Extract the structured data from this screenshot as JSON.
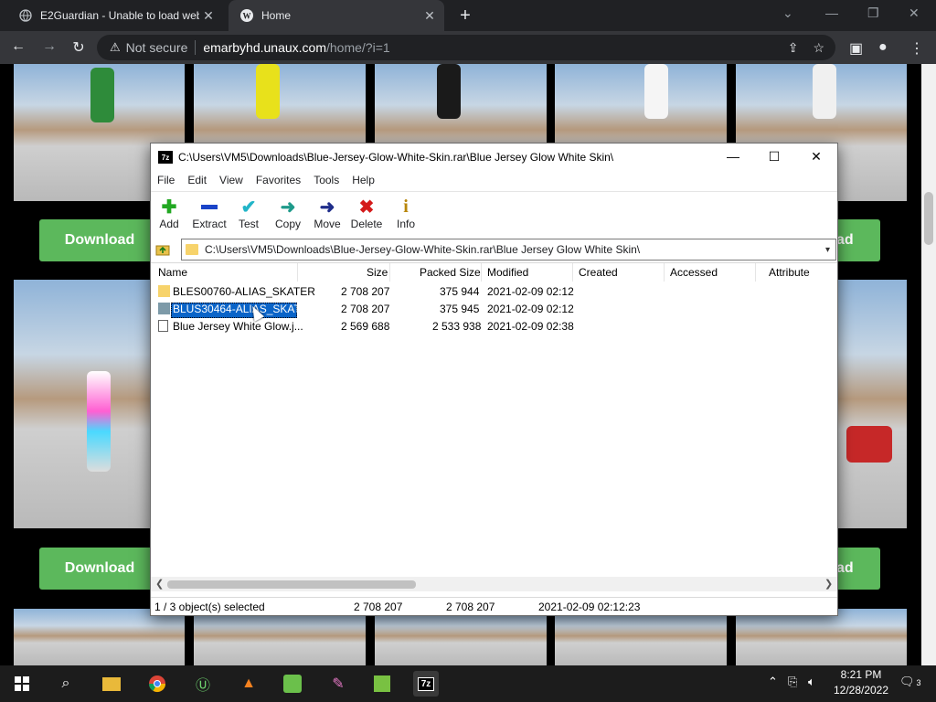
{
  "browser": {
    "tabs": [
      {
        "title": "E2Guardian - Unable to load web",
        "icon": "globe-icon"
      },
      {
        "title": "Home",
        "icon": "wordpress-icon"
      }
    ],
    "address": {
      "security_label": "Not secure",
      "host": "emarbyhd.unaux.com",
      "path": "/home/?i=1"
    }
  },
  "page": {
    "download_label": "Download",
    "download_partial_label": "ad"
  },
  "sevenzip": {
    "title": "C:\\Users\\VM5\\Downloads\\Blue-Jersey-Glow-White-Skin.rar\\Blue Jersey Glow White Skin\\",
    "logo": "7z",
    "menu": [
      "File",
      "Edit",
      "View",
      "Favorites",
      "Tools",
      "Help"
    ],
    "toolbar": [
      {
        "label": "Add",
        "icon": "plus-icon"
      },
      {
        "label": "Extract",
        "icon": "minus-icon"
      },
      {
        "label": "Test",
        "icon": "check-icon"
      },
      {
        "label": "Copy",
        "icon": "copy-arrow-icon"
      },
      {
        "label": "Move",
        "icon": "move-arrow-icon"
      },
      {
        "label": "Delete",
        "icon": "delete-x-icon"
      },
      {
        "label": "Info",
        "icon": "info-icon"
      }
    ],
    "address": "C:\\Users\\VM5\\Downloads\\Blue-Jersey-Glow-White-Skin.rar\\Blue Jersey Glow White Skin\\",
    "columns": [
      "Name",
      "Size",
      "Packed Size",
      "Modified",
      "Created",
      "Accessed",
      "Attribute"
    ],
    "rows": [
      {
        "name": "BLES00760-ALIAS_SKATER",
        "size": "2 708 207",
        "packed": "375 944",
        "modified": "2021-02-09 02:12"
      },
      {
        "name": "BLUS30464-ALIAS_SKAT...",
        "size": "2 708 207",
        "packed": "375 945",
        "modified": "2021-02-09 02:12"
      },
      {
        "name": "Blue Jersey White Glow.j...",
        "size": "2 569 688",
        "packed": "2 533 938",
        "modified": "2021-02-09 02:38"
      }
    ],
    "status": {
      "selected": "1 / 3 object(s) selected",
      "size": "2 708 207",
      "packed": "2 708 207",
      "modified": "2021-02-09 02:12:23"
    }
  },
  "taskbar": {
    "time": "8:21 PM",
    "date": "12/28/2022",
    "notifications": "3"
  }
}
